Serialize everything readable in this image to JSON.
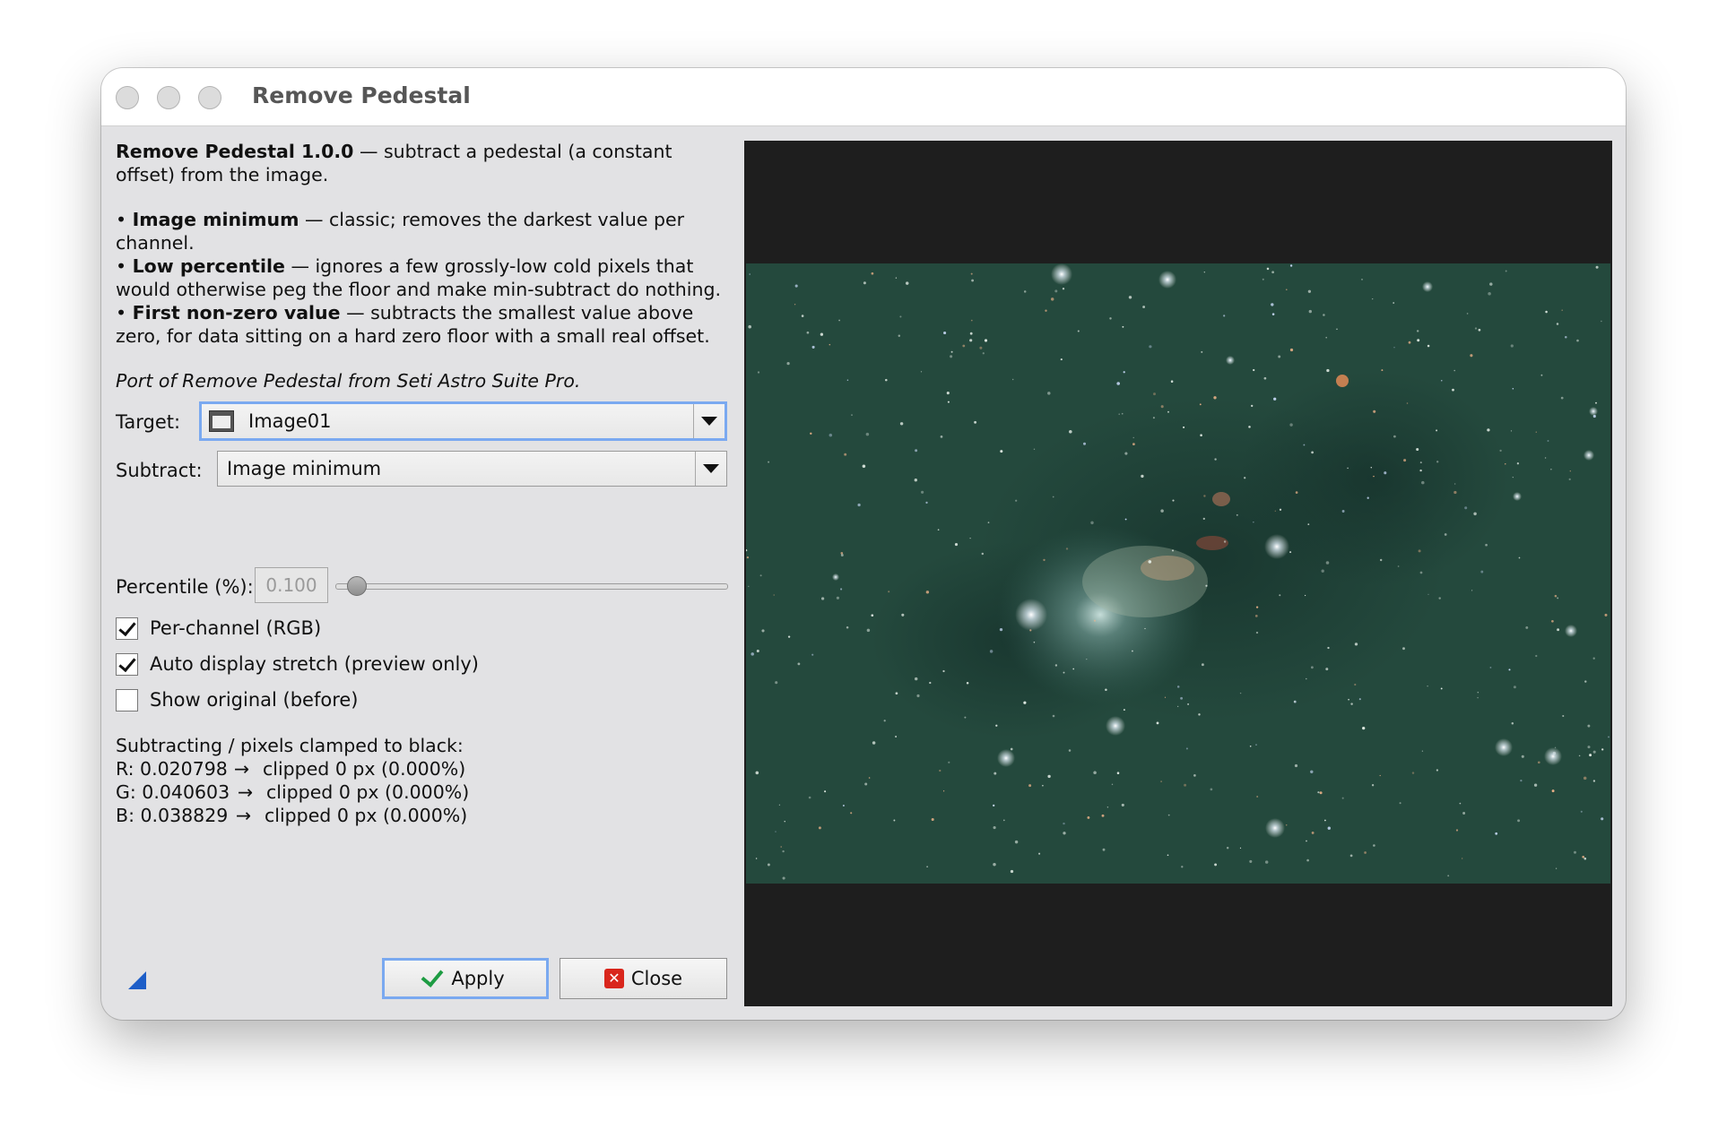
{
  "window": {
    "title": "Remove Pedestal"
  },
  "description": {
    "heading_bold": "Remove Pedestal 1.0.0",
    "heading_rest": " — subtract a pedestal (a constant offset) from the image.",
    "bullets": [
      {
        "bold": "Image minimum",
        "rest": " — classic; removes the darkest value per channel."
      },
      {
        "bold": "Low percentile",
        "rest": " — ignores a few grossly-low cold pixels that would otherwise peg the floor and make min-subtract do nothing."
      },
      {
        "bold": "First non-zero value",
        "rest": " — subtracts the smallest value above zero, for data sitting on a hard zero floor with a small real offset."
      }
    ],
    "port_note": "Port of Remove Pedestal from Seti Astro Suite Pro."
  },
  "target": {
    "label": "Target:",
    "value": "Image01",
    "icon": "image-window-icon"
  },
  "subtract": {
    "label": "Subtract:",
    "value": "Image minimum"
  },
  "percentile": {
    "label": "Percentile (%):",
    "value": "0.100",
    "slider_fraction": 0.03
  },
  "checkboxes": {
    "per_channel": {
      "label": "Per-channel (RGB)",
      "checked": true
    },
    "auto_stretch": {
      "label": "Auto display stretch (preview only)",
      "checked": true
    },
    "show_original": {
      "label": "Show original (before)",
      "checked": false
    }
  },
  "stats": {
    "header": "Subtracting / pixels clamped to black:",
    "rows": [
      {
        "channel": "R: 0.020798",
        "result": "clipped 0 px (0.000%)"
      },
      {
        "channel": "G: 0.040603",
        "result": "clipped 0 px (0.000%)"
      },
      {
        "channel": "B: 0.038829",
        "result": "clipped 0 px (0.000%)"
      }
    ],
    "arrow": "→"
  },
  "buttons": {
    "apply": "Apply",
    "close": "Close",
    "close_icon": "✕"
  },
  "colors": {
    "accent_focus": "#7aa9f0",
    "apply_check": "#1e9c43",
    "close_red": "#d9261c",
    "nebula_bg": "#24493d"
  }
}
